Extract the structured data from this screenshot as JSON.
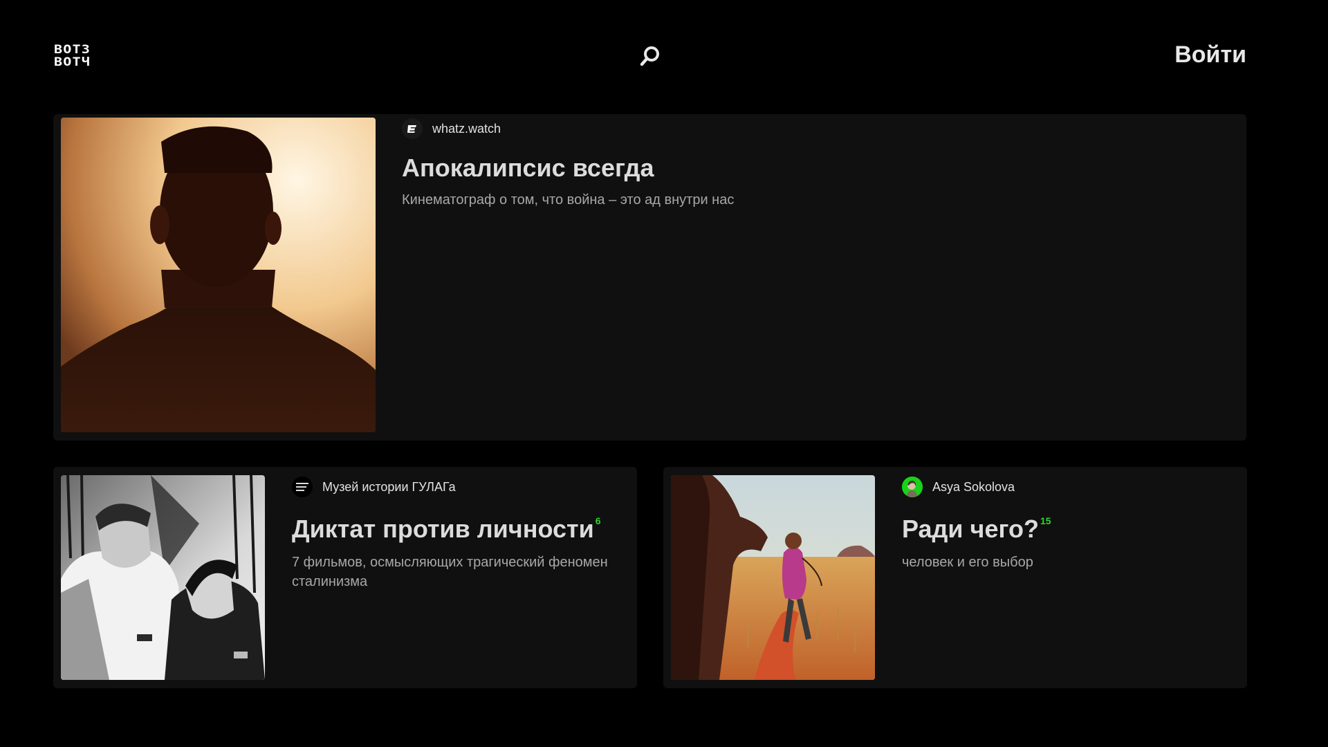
{
  "header": {
    "logo": {
      "line1": "ВОТЗ",
      "line2": "ВОТЧ"
    },
    "search_icon": "search-icon",
    "login_label": "Войти"
  },
  "cards": [
    {
      "author": "whatz.watch",
      "title": "Апокалипсис всегда",
      "count": "",
      "description": "Кинематограф о том, что война – это ад внутри нас"
    },
    {
      "author": "Музей истории ГУЛАГа",
      "avatar_text": "Музей истории ГУЛАГа",
      "title": "Диктат против личности",
      "count": "6",
      "description": "7 фильмов, осмысляющих трагический феномен сталинизма"
    },
    {
      "author": "Asya Sokolova",
      "title": "Ради чего?",
      "count": "15",
      "description": "человек и его выбор"
    }
  ],
  "colors": {
    "background": "#000000",
    "card": "#101010",
    "count_accent": "#2ed42e",
    "avatar_green": "#19d219"
  }
}
